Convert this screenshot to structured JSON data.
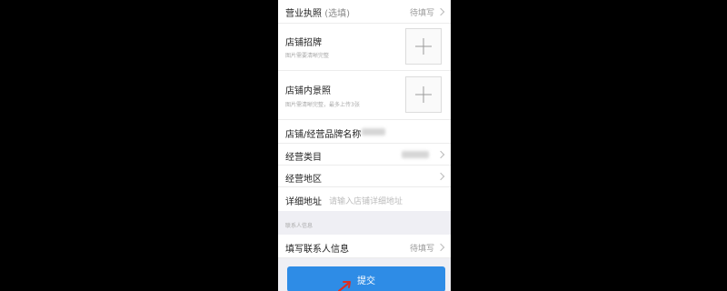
{
  "form": {
    "license": {
      "label": "营业执照",
      "optional": "(选填)",
      "status": "待填写"
    },
    "sign_photo": {
      "label": "店铺招牌",
      "hint": "图片需要清晰完整"
    },
    "interior_photo": {
      "label": "店铺内景照",
      "hint": "图片需清晰完整，最多上传3张"
    },
    "brand_name": {
      "label": "店铺/经营品牌名称"
    },
    "category": {
      "label": "经营类目"
    },
    "region": {
      "label": "经营地区"
    },
    "address": {
      "label": "详细地址",
      "placeholder": "请输入店铺详细地址"
    },
    "contact_section": {
      "title": "联系人信息"
    },
    "contact": {
      "label": "填写联系人信息",
      "status": "待填写"
    }
  },
  "submit": {
    "label": "提交"
  },
  "colors": {
    "accent": "#2e8ce6",
    "arrow": "#d93025"
  }
}
